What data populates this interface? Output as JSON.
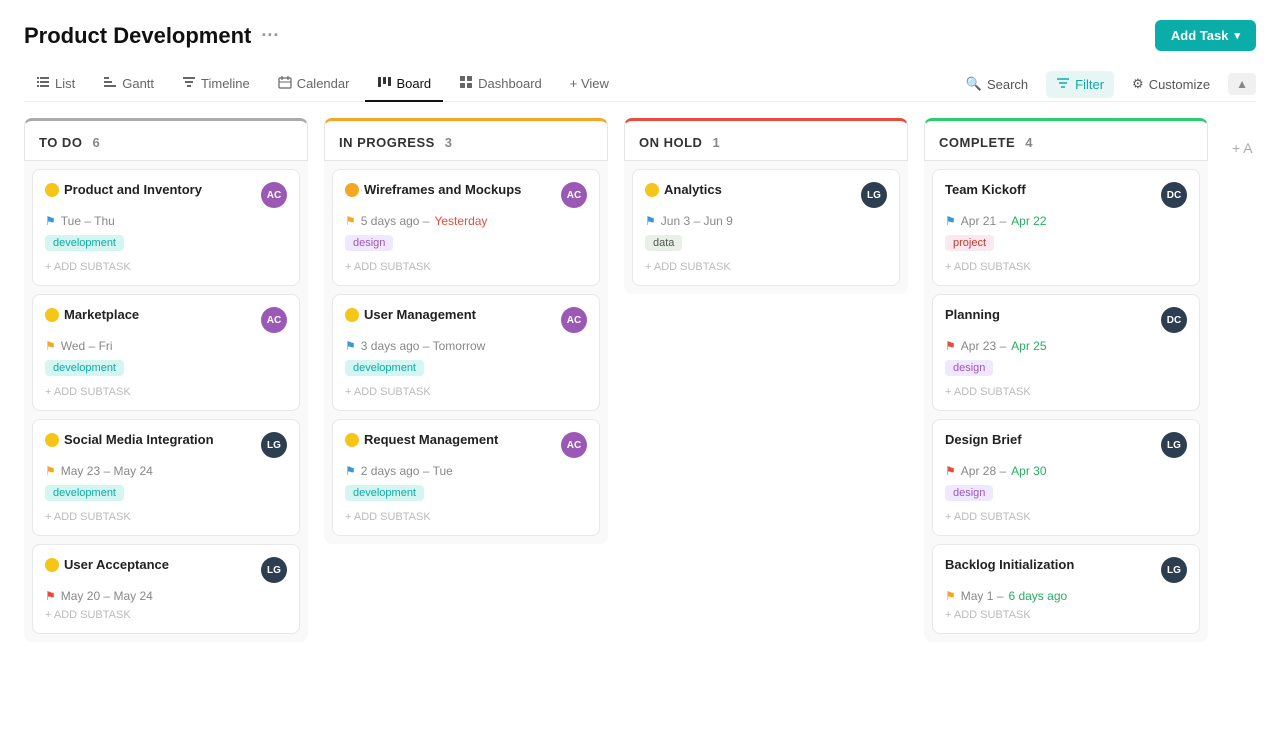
{
  "header": {
    "title": "Product Development",
    "dots_label": "···",
    "add_task_label": "Add Task"
  },
  "nav": {
    "tabs": [
      {
        "id": "list",
        "label": "List",
        "icon": "≡"
      },
      {
        "id": "gantt",
        "label": "Gantt",
        "icon": "▦"
      },
      {
        "id": "timeline",
        "label": "Timeline",
        "icon": "▤"
      },
      {
        "id": "calendar",
        "label": "Calendar",
        "icon": "▦"
      },
      {
        "id": "board",
        "label": "Board",
        "icon": "▦",
        "active": true
      },
      {
        "id": "dashboard",
        "label": "Dashboard",
        "icon": "▦"
      },
      {
        "id": "view",
        "label": "+ View",
        "icon": ""
      }
    ],
    "search_label": "Search",
    "filter_label": "Filter",
    "customize_label": "Customize"
  },
  "columns": [
    {
      "id": "todo",
      "title": "TO DO",
      "count": 6,
      "color": "#aaaaaa",
      "cards": [
        {
          "id": "c1",
          "title": "Product and Inventory",
          "status_color": "yellow",
          "date": "Tue – Thu",
          "flag_color": "blue",
          "tag": "development",
          "tag_class": "development",
          "avatar_initials": "AC",
          "avatar_class": "purple",
          "add_subtask": "+ ADD SUBTASK"
        },
        {
          "id": "c2",
          "title": "Marketplace",
          "status_color": "yellow",
          "date": "Wed – Fri",
          "flag_color": "yellow",
          "tag": "development",
          "tag_class": "development",
          "avatar_initials": "AC",
          "avatar_class": "purple",
          "add_subtask": "+ ADD SUBTASK"
        },
        {
          "id": "c3",
          "title": "Social Media Integration",
          "status_color": "yellow",
          "date": "May 23 – May 24",
          "flag_color": "yellow",
          "tag": "development",
          "tag_class": "development",
          "avatar_initials": "LG",
          "avatar_class": "dark",
          "add_subtask": "+ ADD SUBTASK"
        },
        {
          "id": "c4",
          "title": "User Acceptance",
          "status_color": "yellow",
          "date": "May 20 – May 24",
          "flag_color": "red",
          "tag": "",
          "tag_class": "",
          "avatar_initials": "LG",
          "avatar_class": "dark",
          "add_subtask": "+ ADD SUBTASK"
        }
      ]
    },
    {
      "id": "inprogress",
      "title": "IN PROGRESS",
      "count": 3,
      "color": "#f5a623",
      "cards": [
        {
          "id": "c5",
          "title": "Wireframes and Mockups",
          "status_color": "orange",
          "date": "5 days ago – Yesterday",
          "flag_color": "yellow",
          "date_overdue": "Yesterday",
          "tag": "design",
          "tag_class": "design",
          "avatar_initials": "AC",
          "avatar_class": "purple",
          "add_subtask": "+ ADD SUBTASK"
        },
        {
          "id": "c6",
          "title": "User Management",
          "status_color": "yellow",
          "date": "3 days ago – Tomorrow",
          "flag_color": "blue",
          "tag": "development",
          "tag_class": "development",
          "avatar_initials": "AC",
          "avatar_class": "purple",
          "add_subtask": "+ ADD SUBTASK"
        },
        {
          "id": "c7",
          "title": "Request Management",
          "status_color": "yellow",
          "date": "2 days ago – Tue",
          "flag_color": "blue",
          "tag": "development",
          "tag_class": "development",
          "avatar_initials": "AC",
          "avatar_class": "purple",
          "add_subtask": "+ ADD SUBTASK"
        }
      ]
    },
    {
      "id": "onhold",
      "title": "ON HOLD",
      "count": 1,
      "color": "#e74c3c",
      "cards": [
        {
          "id": "c8",
          "title": "Analytics",
          "status_color": "yellow",
          "date": "Jun 3 – Jun 9",
          "flag_color": "blue",
          "tag": "data",
          "tag_class": "data",
          "avatar_initials": "LG",
          "avatar_class": "dark",
          "add_subtask": "+ ADD SUBTASK"
        }
      ]
    },
    {
      "id": "complete",
      "title": "COMPLETE",
      "count": 4,
      "color": "#2ecc71",
      "cards": [
        {
          "id": "c9",
          "title": "Team Kickoff",
          "status_color": "",
          "date": "Apr 21 – Apr 22",
          "date_green": "Apr 22",
          "flag_color": "blue",
          "tag": "project",
          "tag_class": "project",
          "avatar_initials": "DC",
          "avatar_class": "dark",
          "add_subtask": "+ ADD SUBTASK"
        },
        {
          "id": "c10",
          "title": "Planning",
          "status_color": "",
          "date": "Apr 23 – Apr 25",
          "date_green": "Apr 25",
          "flag_color": "red",
          "tag": "design",
          "tag_class": "design",
          "avatar_initials": "DC",
          "avatar_class": "dark",
          "add_subtask": "+ ADD SUBTASK"
        },
        {
          "id": "c11",
          "title": "Design Brief",
          "status_color": "",
          "date": "Apr 28 – Apr 30",
          "date_green": "Apr 30",
          "flag_color": "red",
          "tag": "design",
          "tag_class": "design",
          "avatar_initials": "LG",
          "avatar_class": "dark",
          "add_subtask": "+ ADD SUBTASK"
        },
        {
          "id": "c12",
          "title": "Backlog Initialization",
          "status_color": "",
          "date": "May 1 – 6 days ago",
          "date_green": "6 days ago",
          "flag_color": "yellow",
          "tag": "",
          "tag_class": "",
          "avatar_initials": "LG",
          "avatar_class": "dark",
          "add_subtask": "+ ADD SUBTASK"
        }
      ]
    }
  ],
  "add_column_label": "+ A"
}
